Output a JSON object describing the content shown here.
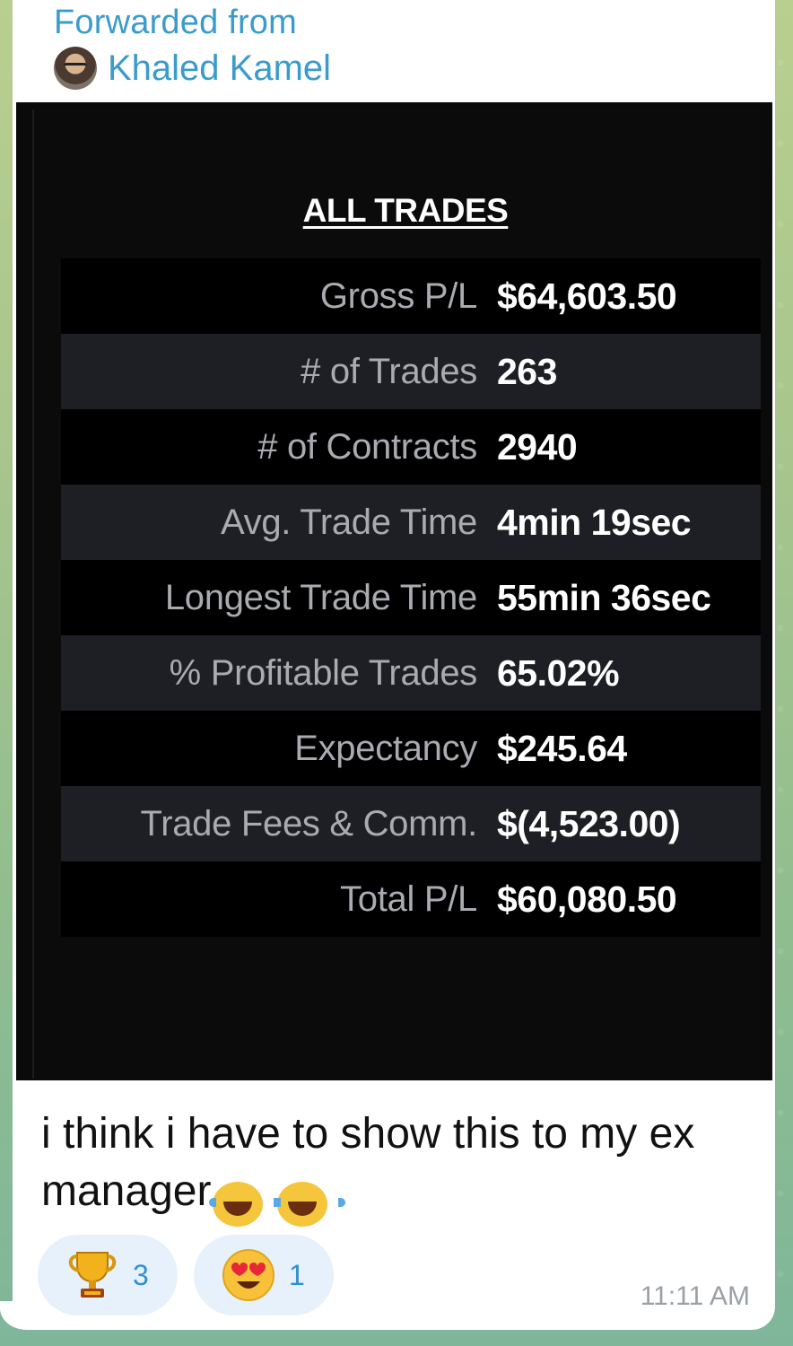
{
  "forward": {
    "label": "Forwarded from",
    "sender": "Khaled Kamel"
  },
  "photo": {
    "title": "ALL TRADES",
    "rows": [
      {
        "label": "Gross P/L",
        "value": "$64,603.50"
      },
      {
        "label": "# of Trades",
        "value": "263"
      },
      {
        "label": "# of Contracts",
        "value": "2940"
      },
      {
        "label": "Avg. Trade Time",
        "value": "4min 19sec"
      },
      {
        "label": "Longest Trade Time",
        "value": "55min 36sec"
      },
      {
        "label": "% Profitable Trades",
        "value": "65.02%"
      },
      {
        "label": "Expectancy",
        "value": "$245.64"
      },
      {
        "label": "Trade Fees & Comm.",
        "value": "$(4,523.00)"
      },
      {
        "label": "Total P/L",
        "value": "$60,080.50"
      }
    ]
  },
  "message": {
    "text": "i think i have to show this to my ex manager",
    "emojis": [
      "😂",
      "😂"
    ]
  },
  "reactions": [
    {
      "icon": "trophy-icon",
      "count": "3"
    },
    {
      "icon": "heart-eyes-icon",
      "count": "1"
    }
  ],
  "time": "11:11 AM"
}
